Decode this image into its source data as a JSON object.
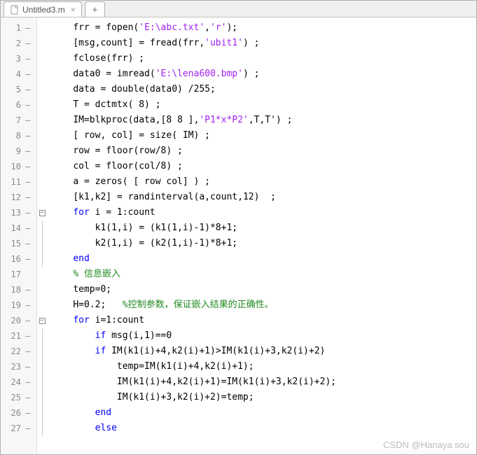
{
  "tab": {
    "title": "Untitled3.m",
    "close": "×",
    "plus": "+"
  },
  "watermark": "CSDN @Hanaya sou",
  "lines": [
    {
      "n": "1",
      "d": "—",
      "fold": "",
      "ind": 1,
      "seg": [
        {
          "t": "frr = fopen("
        },
        {
          "t": "'E:\\abc.txt'",
          "c": "s-str"
        },
        {
          "t": ","
        },
        {
          "t": "'r'",
          "c": "s-str"
        },
        {
          "t": ");"
        }
      ]
    },
    {
      "n": "2",
      "d": "—",
      "fold": "",
      "ind": 1,
      "seg": [
        {
          "t": "[msg,count] = fread(frr,"
        },
        {
          "t": "'ubit1'",
          "c": "s-str"
        },
        {
          "t": ") ;"
        }
      ]
    },
    {
      "n": "3",
      "d": "—",
      "fold": "",
      "ind": 1,
      "seg": [
        {
          "t": "fclose(frr) ;"
        }
      ]
    },
    {
      "n": "4",
      "d": "—",
      "fold": "",
      "ind": 1,
      "seg": [
        {
          "t": "data0 = imread("
        },
        {
          "t": "'E:\\lena600.bmp'",
          "c": "s-str"
        },
        {
          "t": ") ;"
        }
      ]
    },
    {
      "n": "5",
      "d": "—",
      "fold": "",
      "ind": 1,
      "seg": [
        {
          "t": "data = double(data0) /255;"
        }
      ]
    },
    {
      "n": "6",
      "d": "—",
      "fold": "",
      "ind": 1,
      "seg": [
        {
          "t": "T = dctmtx( 8) ;"
        }
      ]
    },
    {
      "n": "7",
      "d": "—",
      "fold": "",
      "ind": 1,
      "seg": [
        {
          "t": "IM=blkproc(data,[8 8 ],"
        },
        {
          "t": "'P1*x*P2'",
          "c": "s-str"
        },
        {
          "t": ",T,T') ;"
        }
      ]
    },
    {
      "n": "8",
      "d": "—",
      "fold": "",
      "ind": 1,
      "seg": [
        {
          "t": "[ row, col] = size( IM) ;"
        }
      ]
    },
    {
      "n": "9",
      "d": "—",
      "fold": "",
      "ind": 1,
      "seg": [
        {
          "t": "row = floor(row/8) ;"
        }
      ]
    },
    {
      "n": "10",
      "d": "—",
      "fold": "",
      "ind": 1,
      "seg": [
        {
          "t": "col = floor(col/8) ;"
        }
      ]
    },
    {
      "n": "11",
      "d": "—",
      "fold": "",
      "ind": 1,
      "seg": [
        {
          "t": "a = zeros( [ row col] ) ;"
        }
      ]
    },
    {
      "n": "12",
      "d": "—",
      "fold": "",
      "ind": 1,
      "seg": [
        {
          "t": "[k1,k2] = randinterval(a,count,12)  ;"
        }
      ]
    },
    {
      "n": "13",
      "d": "—",
      "fold": "box",
      "ind": 1,
      "seg": [
        {
          "t": "for",
          "c": "s-kw"
        },
        {
          "t": " i = 1:count"
        }
      ]
    },
    {
      "n": "14",
      "d": "—",
      "fold": "bar",
      "ind": 2,
      "seg": [
        {
          "t": "k1(1,i) = (k1(1,i)-1)*8+1;"
        }
      ]
    },
    {
      "n": "15",
      "d": "—",
      "fold": "bar",
      "ind": 2,
      "seg": [
        {
          "t": "k2(1,i) = (k2(1,i)-1)*8+1;"
        }
      ]
    },
    {
      "n": "16",
      "d": "—",
      "fold": "bar",
      "ind": 1,
      "seg": [
        {
          "t": "end",
          "c": "s-kw"
        }
      ]
    },
    {
      "n": "17",
      "d": "",
      "fold": "",
      "ind": 1,
      "seg": [
        {
          "t": "% 信息嵌入",
          "c": "s-cm"
        }
      ]
    },
    {
      "n": "18",
      "d": "—",
      "fold": "",
      "ind": 1,
      "seg": [
        {
          "t": "temp=0;"
        }
      ]
    },
    {
      "n": "19",
      "d": "—",
      "fold": "",
      "ind": 1,
      "seg": [
        {
          "t": "H=0.2;   "
        },
        {
          "t": "%控制参数，保证嵌入结果的正确性。",
          "c": "s-cm"
        }
      ]
    },
    {
      "n": "20",
      "d": "—",
      "fold": "box",
      "ind": 1,
      "seg": [
        {
          "t": "for",
          "c": "s-kw"
        },
        {
          "t": " i=1:count"
        }
      ]
    },
    {
      "n": "21",
      "d": "—",
      "fold": "bar",
      "ind": 2,
      "seg": [
        {
          "t": "if",
          "c": "s-kw"
        },
        {
          "t": " msg(i,1)==0"
        }
      ]
    },
    {
      "n": "22",
      "d": "—",
      "fold": "bar",
      "ind": 2,
      "seg": [
        {
          "t": "if",
          "c": "s-kw"
        },
        {
          "t": " IM(k1(i)+4,k2(i)+1)>IM(k1(i)+3,k2(i)+2)"
        }
      ]
    },
    {
      "n": "23",
      "d": "—",
      "fold": "bar",
      "ind": 3,
      "seg": [
        {
          "t": "temp=IM(k1(i)+4,k2(i)+1);"
        }
      ]
    },
    {
      "n": "24",
      "d": "—",
      "fold": "bar",
      "ind": 3,
      "seg": [
        {
          "t": "IM(k1(i)+4,k2(i)+1)=IM(k1(i)+3,k2(i)+2);"
        }
      ]
    },
    {
      "n": "25",
      "d": "—",
      "fold": "bar",
      "ind": 3,
      "seg": [
        {
          "t": "IM(k1(i)+3,k2(i)+2)=temp;"
        }
      ]
    },
    {
      "n": "26",
      "d": "—",
      "fold": "bar",
      "ind": 2,
      "seg": [
        {
          "t": "end",
          "c": "s-kw"
        }
      ]
    },
    {
      "n": "27",
      "d": "—",
      "fold": "bar",
      "ind": 2,
      "seg": [
        {
          "t": "else",
          "c": "s-kw"
        }
      ]
    }
  ]
}
